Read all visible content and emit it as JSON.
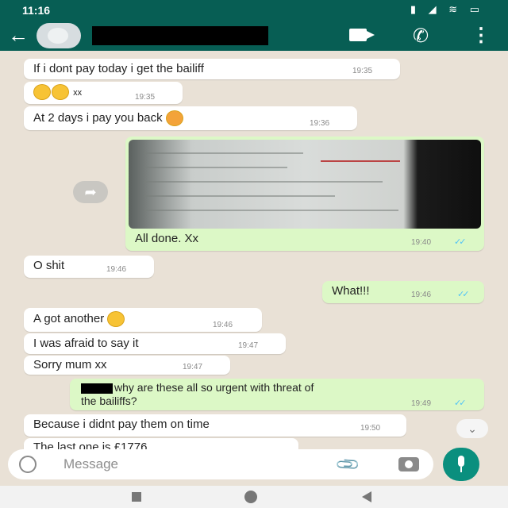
{
  "status_bar": {
    "time": "11:16",
    "icons": "▮ ◢ ≋ ▭"
  },
  "header": {
    "back_icon": "←",
    "call_icon": "✆",
    "menu_icon": "⋮"
  },
  "messages": [
    {
      "direction": "in",
      "text": "If i dont pay today i get the bailiff",
      "time": "19:35"
    },
    {
      "direction": "in",
      "emojis": 2,
      "text": "xx",
      "time": "19:35"
    },
    {
      "direction": "in",
      "text": "At 2 days i pay you back",
      "emojis": 1,
      "time": "19:36"
    },
    {
      "direction": "out",
      "type": "image",
      "caption": "All done. Xx",
      "time": "19:40",
      "read": true
    },
    {
      "direction": "in",
      "text": "O shit",
      "time": "19:46"
    },
    {
      "direction": "out",
      "text": "What!!!",
      "time": "19:46",
      "read": true
    },
    {
      "direction": "in",
      "text": "A got another",
      "emojis": 1,
      "time": "19:46"
    },
    {
      "direction": "in",
      "text": "I was afraid to say it",
      "time": "19:47"
    },
    {
      "direction": "in",
      "text": "Sorry mum xx",
      "time": "19:47"
    },
    {
      "direction": "out",
      "text_line1": "why are these all so urgent with threat of",
      "text_line2": "the bailiffs?",
      "time": "19:49",
      "read": true
    },
    {
      "direction": "in",
      "text": "Because i didnt pay them on time",
      "time": "19:50"
    },
    {
      "direction": "in",
      "text": "The last one is £1776",
      "time": ""
    }
  ],
  "ticks": "✓✓",
  "forward_icon": "➦",
  "scroll_down_icon": "⌄",
  "input": {
    "placeholder": "Message",
    "attach_icon": "📎"
  },
  "colors": {
    "header": "#075e54",
    "incoming": "#ffffff",
    "outgoing": "#dcf8c6",
    "background": "#e9e1d6",
    "mic": "#0a8f7e",
    "read_ticks": "#4fc3f7"
  }
}
